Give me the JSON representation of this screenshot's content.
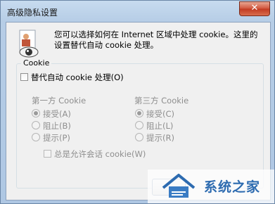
{
  "window": {
    "title": "高级隐私设置",
    "close_glyph": "✕"
  },
  "description": "您可以选择如何在 Internet 区域中处理 cookie。这里的设置替代自动 cookie 处理。",
  "cookie_group": {
    "legend": "Cookie",
    "override_label": "替代自动 cookie 处理(O)",
    "first_party": {
      "title": "第一方 Cookie",
      "options": [
        "接受(A)",
        "阻止(B)",
        "提示(P)"
      ],
      "selected": "接受(A)"
    },
    "third_party": {
      "title": "第三方 Cookie",
      "options": [
        "接受(C)",
        "阻止(L)",
        "提示(R)"
      ],
      "selected": "接受(C)"
    },
    "session_label": "总是允许会话 cookie(W)"
  },
  "watermark": {
    "text": "系统之家"
  },
  "colors": {
    "accent": "#2d6bb0",
    "disabled_text": "#8e8e8e"
  }
}
